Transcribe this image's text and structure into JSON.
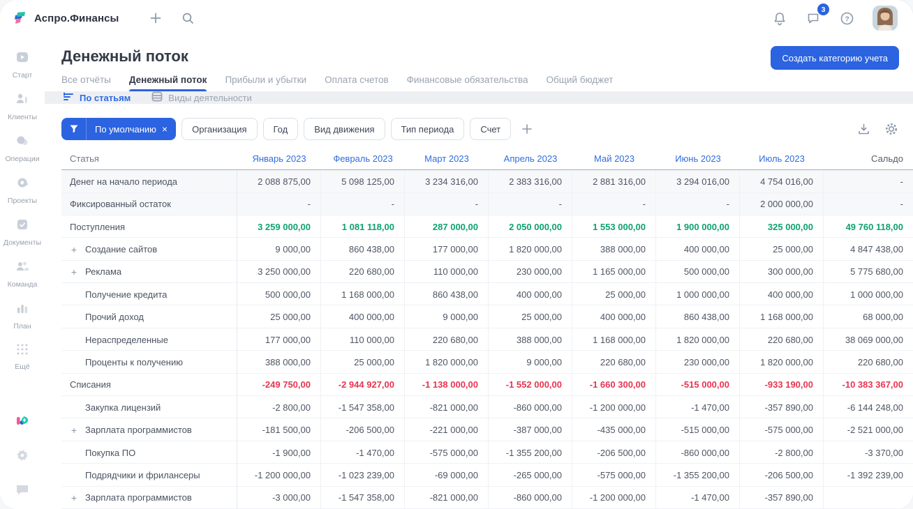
{
  "topbar": {
    "app_name": "Аспро.Финансы",
    "chat_badge": "3"
  },
  "sidebar": {
    "items": [
      {
        "id": "start",
        "label": "Старт",
        "icon": "start-icon"
      },
      {
        "id": "clients",
        "label": "Клиенты",
        "icon": "clients-icon"
      },
      {
        "id": "operations",
        "label": "Операции",
        "icon": "operations-icon"
      },
      {
        "id": "projects",
        "label": "Проекты",
        "icon": "projects-icon"
      },
      {
        "id": "documents",
        "label": "Документы",
        "icon": "documents-icon"
      },
      {
        "id": "team",
        "label": "Команда",
        "icon": "team-icon"
      },
      {
        "id": "plan",
        "label": "План",
        "icon": "plan-icon"
      },
      {
        "id": "more",
        "label": "Ещё",
        "icon": "more-grid-icon"
      }
    ]
  },
  "header": {
    "title": "Денежный поток",
    "create_button": "Создать категорию учета",
    "tabs": [
      {
        "label": "Все отчёты",
        "active": false
      },
      {
        "label": "Денежный поток",
        "active": true
      },
      {
        "label": "Прибыли и убытки",
        "active": false
      },
      {
        "label": "Оплата счетов",
        "active": false
      },
      {
        "label": "Финансовые обязательства",
        "active": false
      },
      {
        "label": "Общий бюджет",
        "active": false
      }
    ]
  },
  "view_switcher": [
    {
      "label": "По статьям",
      "active": true,
      "icon": "sort-lines-icon"
    },
    {
      "label": "Виды деятельности",
      "active": false,
      "icon": "stack-icon"
    }
  ],
  "filters": {
    "active_label": "По умолчанию",
    "close_glyph": "×",
    "chips": [
      "Организация",
      "Год",
      "Вид движения",
      "Тип периода",
      "Счет"
    ]
  },
  "table": {
    "columns": [
      "Статья",
      "Январь 2023",
      "Февраль 2023",
      "Март 2023",
      "Апрель 2023",
      "Май 2023",
      "Июнь 2023",
      "Июль 2023",
      "Сальдо"
    ],
    "rows": [
      {
        "label": "Денег на начало периода",
        "type": "muted",
        "plus": false,
        "values": [
          "2 088 875,00",
          "5 098 125,00",
          "3 234 316,00",
          "2 383 316,00",
          "2 881 316,00",
          "3 294 016,00",
          "4 754 016,00",
          "-"
        ]
      },
      {
        "label": "Фиксированный остаток",
        "type": "muted",
        "plus": false,
        "values": [
          "-",
          "-",
          "-",
          "-",
          "-",
          "-",
          "2 000 000,00",
          "-"
        ]
      },
      {
        "label": "Поступления",
        "type": "income",
        "plus": false,
        "values": [
          "3 259 000,00",
          "1 081 118,00",
          "287 000,00",
          "2 050 000,00",
          "1 553 000,00",
          "1 900 000,00",
          "325 000,00",
          "49 760 118,00"
        ]
      },
      {
        "label": "Создание сайтов",
        "type": "child",
        "plus": true,
        "values": [
          "9 000,00",
          "860 438,00",
          "177 000,00",
          "1 820 000,00",
          "388 000,00",
          "400 000,00",
          "25 000,00",
          "4 847 438,00"
        ]
      },
      {
        "label": "Реклама",
        "type": "child",
        "plus": true,
        "values": [
          "3 250 000,00",
          "220 680,00",
          "110 000,00",
          "230 000,00",
          "1 165 000,00",
          "500 000,00",
          "300 000,00",
          "5 775 680,00"
        ]
      },
      {
        "label": "Получение кредита",
        "type": "child",
        "plus": false,
        "values": [
          "500 000,00",
          "1 168 000,00",
          "860 438,00",
          "400 000,00",
          "25 000,00",
          "1 000 000,00",
          "400 000,00",
          "1 000 000,00"
        ]
      },
      {
        "label": "Прочий доход",
        "type": "child",
        "plus": false,
        "values": [
          "25 000,00",
          "400 000,00",
          "9 000,00",
          "25 000,00",
          "400 000,00",
          "860 438,00",
          "1 168 000,00",
          "68 000,00"
        ]
      },
      {
        "label": "Нераспределенные",
        "type": "child",
        "plus": false,
        "values": [
          "177 000,00",
          "110 000,00",
          "220 680,00",
          "388 000,00",
          "1 168 000,00",
          "1 820 000,00",
          "220 680,00",
          "38 069 000,00"
        ]
      },
      {
        "label": "Проценты к получению",
        "type": "child",
        "plus": false,
        "values": [
          "388 000,00",
          "25 000,00",
          "1 820 000,00",
          "9 000,00",
          "220 680,00",
          "230 000,00",
          "1 820 000,00",
          "220 680,00"
        ]
      },
      {
        "label": "Списания",
        "type": "expense",
        "plus": false,
        "values": [
          "-249 750,00",
          "-2 944 927,00",
          "-1 138 000,00",
          "-1 552 000,00",
          "-1 660 300,00",
          "-515 000,00",
          "-933 190,00",
          "-10 383 367,00"
        ]
      },
      {
        "label": "Закупка лицензий",
        "type": "child",
        "plus": false,
        "values": [
          "-2 800,00",
          "-1 547 358,00",
          "-821 000,00",
          "-860 000,00",
          "-1 200 000,00",
          "-1 470,00",
          "-357 890,00",
          "-6 144 248,00"
        ]
      },
      {
        "label": "Зарплата программистов",
        "type": "child",
        "plus": true,
        "values": [
          "-181 500,00",
          "-206 500,00",
          "-221 000,00",
          "-387 000,00",
          "-435 000,00",
          "-515 000,00",
          "-575 000,00",
          "-2 521 000,00"
        ]
      },
      {
        "label": "Покупка ПО",
        "type": "child",
        "plus": false,
        "values": [
          "-1 900,00",
          "-1 470,00",
          "-575 000,00",
          "-1 355 200,00",
          "-206 500,00",
          "-860 000,00",
          "-2 800,00",
          "-3 370,00"
        ]
      },
      {
        "label": "Подрядчики и фрилансеры",
        "type": "child",
        "plus": false,
        "values": [
          "-1 200 000,00",
          "-1 023 239,00",
          "-69 000,00",
          "-265 000,00",
          "-575 000,00",
          "-1 355 200,00",
          "-206 500,00",
          "-1 392 239,00"
        ]
      },
      {
        "label": "Зарплата программистов",
        "type": "child",
        "plus": true,
        "values": [
          "-3 000,00",
          "-1 547 358,00",
          "-821 000,00",
          "-860 000,00",
          "-1 200 000,00",
          "-1 470,00",
          "-357 890,00",
          ""
        ]
      }
    ]
  },
  "colors": {
    "accent_blue": "#2B63E0",
    "link_blue": "#2F6CDF",
    "income_green": "#0FA26E",
    "expense_red": "#E73550"
  }
}
